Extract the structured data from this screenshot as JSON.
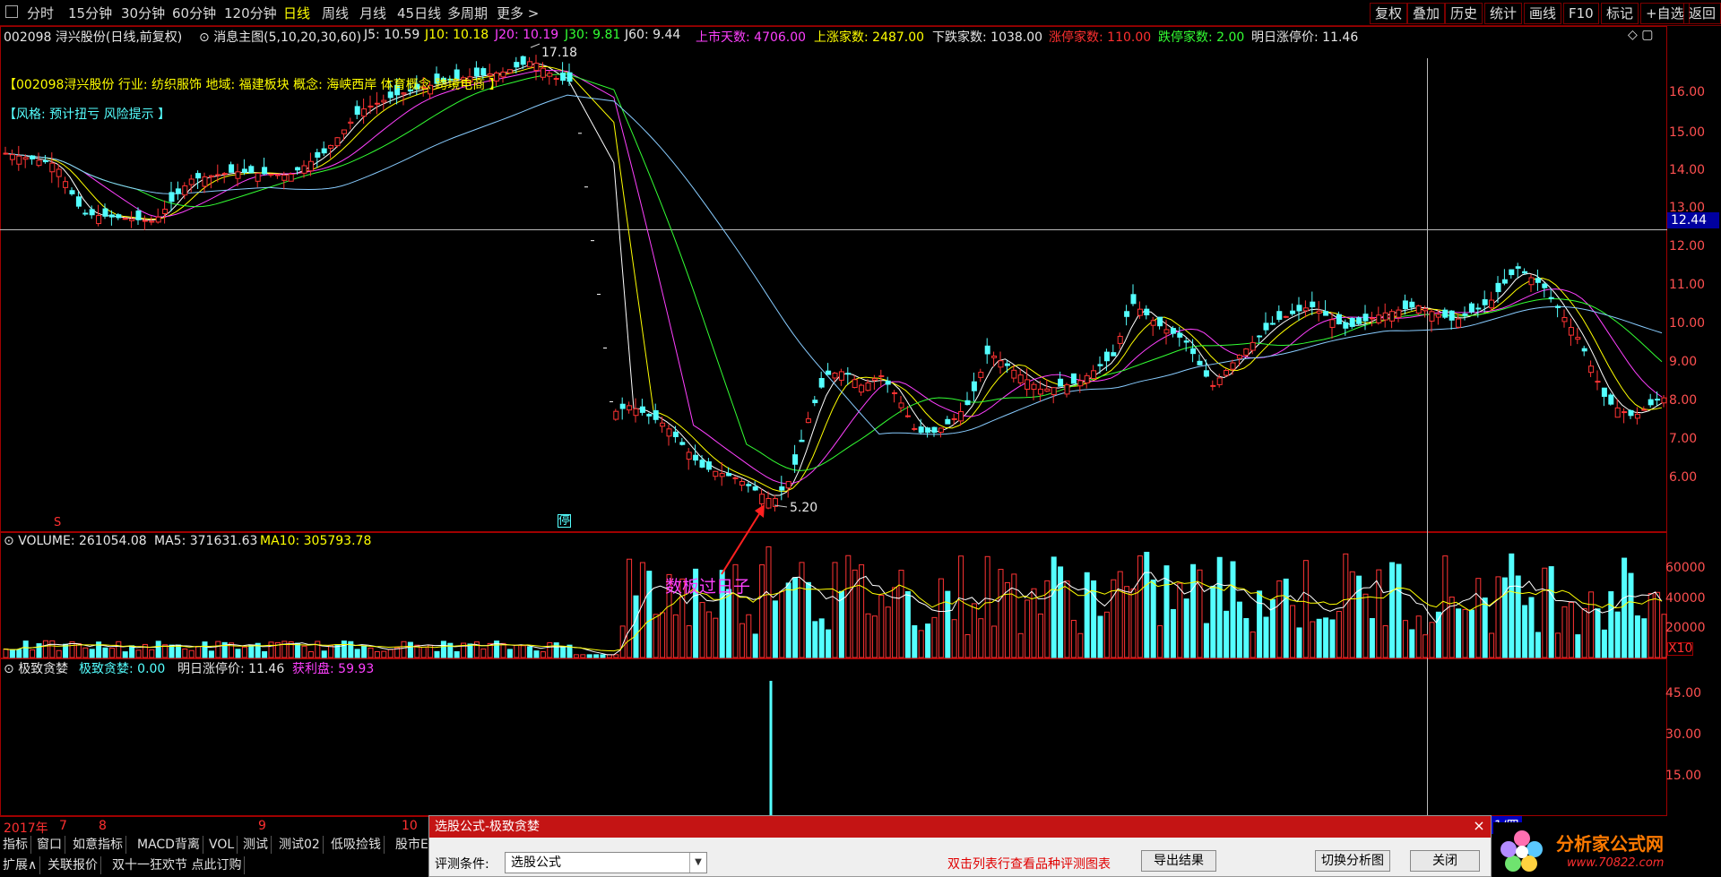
{
  "toolbar": {
    "periods": [
      "分时",
      "15分钟",
      "30分钟",
      "60分钟",
      "120分钟",
      "日线",
      "周线",
      "月线",
      "45日线",
      "多周期",
      "更多 >"
    ],
    "active_period": "日线",
    "right_buttons": [
      "复权",
      "叠加",
      "历史",
      "统计",
      "画线",
      "F10",
      "标记",
      "+自选",
      "返回"
    ]
  },
  "main_chart": {
    "title": "002098 浔兴股份(日线,前复权)",
    "indicator": "消息主图(5,10,20,30,60)",
    "j5": "J5: 10.59",
    "j10": "J10: 10.18",
    "j20": "J20: 10.19",
    "j30": "J30: 9.81",
    "j60": "J60: 9.44",
    "listed_days": "上市天数: 4706.00",
    "up_count": "上涨家数: 2487.00",
    "down_count": "下跌家数: 1038.00",
    "limit_up": "涨停家数: 110.00",
    "limit_down": "跌停家数: 2.00",
    "next_limit": "明日涨停价: 11.46",
    "stock_info": "【002098浔兴股份 行业: 纺织服饰 地域: 福建板块 概念: 海峡西岸 体育概念 跨境电商 】",
    "style_info": "【风格: 预计扭亏 风险提示 】",
    "high_label": "17.18",
    "low_label": "5.20",
    "annotation": "数板过日子",
    "marker_s": "S",
    "marker_stop": "停",
    "price_tag": "12.44",
    "axis": [
      "16.00",
      "15.00",
      "14.00",
      "13.00",
      "12.00",
      "11.00",
      "10.00",
      "9.00",
      "8.00",
      "7.00",
      "6.00"
    ]
  },
  "volume_chart": {
    "label": "VOLUME: 261054.08",
    "ma5": "MA5: 371631.63",
    "ma10": "MA10: 305793.78",
    "axis": [
      "60000",
      "40000",
      "20000"
    ],
    "unit": "X10"
  },
  "indicator_chart": {
    "name": "极致贪婪",
    "value_label": "极致贪婪: 0.00",
    "next_limit": "明日涨停价: 11.46",
    "profit": "获利盘: 59.93",
    "axis": [
      "45.00",
      "30.00",
      "15.00"
    ]
  },
  "date_axis": {
    "year": "2017年",
    "ticks": [
      "7",
      "8",
      "9",
      "10"
    ],
    "right_label": "1/四"
  },
  "bottom_tabs": {
    "row1": [
      "指标",
      "窗口",
      "如意指标",
      "MACD背离",
      "VOL",
      "测试",
      "测试02",
      "低吸捡钱",
      "股市E"
    ],
    "row2": [
      "扩展∧",
      "关联报价",
      "双十一狂欢节 点此订购"
    ]
  },
  "dialog": {
    "title": "选股公式-极致贪婪",
    "condition_label": "评测条件:",
    "condition_value": "选股公式",
    "hint": "双击列表行查看品种评测图表",
    "export_button": "导出结果",
    "switch_button": "切换分析图",
    "close_button": "关闭"
  },
  "watermark": {
    "brand": "分析家公式网",
    "url": "www.70822.com"
  },
  "colors": {
    "up": "#ff3333",
    "down": "#54ffff",
    "accent_red": "#c41414",
    "volume_border": "#ff2020"
  }
}
